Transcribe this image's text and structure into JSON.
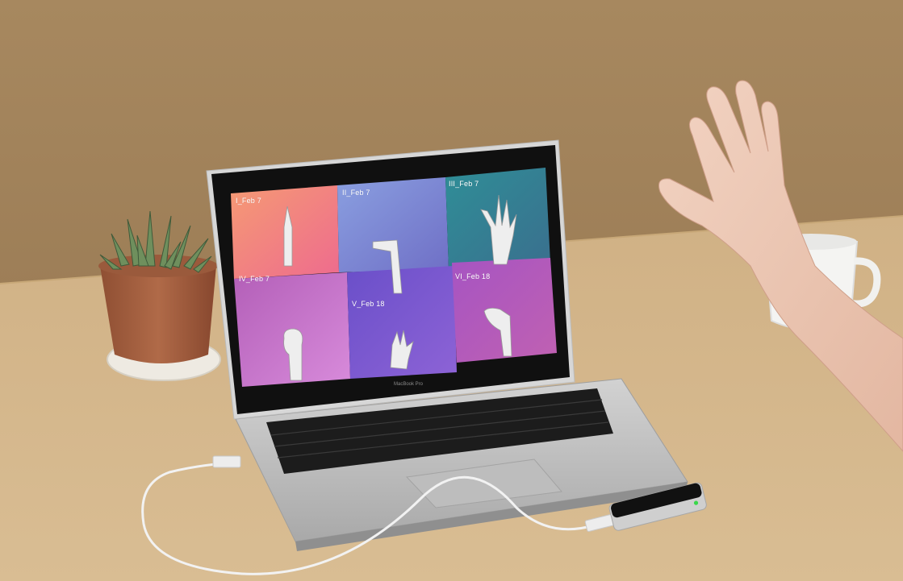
{
  "laptop": {
    "brand": "MacBook Pro"
  },
  "screen": {
    "tiles": [
      {
        "label": "I_Feb 7",
        "gradient": [
          "#f59a74",
          "#ee6b8e"
        ]
      },
      {
        "label": "II_Feb 7",
        "gradient": [
          "#8a9fe0",
          "#6f6fc6"
        ]
      },
      {
        "label": "III_Feb 7",
        "gradient": [
          "#2f8e97",
          "#3a6f8e"
        ]
      },
      {
        "label": "IV_Feb 7",
        "gradient": [
          "#b35fb8",
          "#d88bdb"
        ]
      },
      {
        "label": "V_Feb 18",
        "gradient": [
          "#6a4fc9",
          "#8d63d6"
        ]
      },
      {
        "label": "VI_Feb 18",
        "gradient": [
          "#a654c2",
          "#c061b2"
        ]
      }
    ]
  },
  "colors": {
    "wall": "#a88a62",
    "table": "#d6b98f",
    "laptop_body": "#c9c9c9",
    "sensor_led": "#39d84a"
  }
}
